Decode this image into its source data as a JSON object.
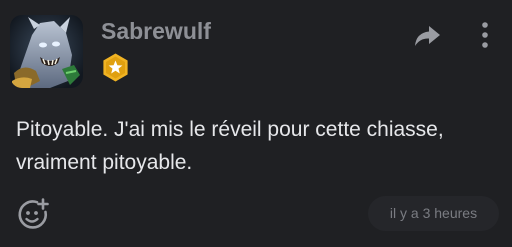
{
  "post": {
    "username": "Sabrewulf",
    "message": "Pitoyable. J'ai mis le réveil pour cette chiasse, vraiment pitoyable.",
    "timestamp": "il y a 3 heures"
  },
  "icons": {
    "share": "share-arrow-icon",
    "more": "vertical-dots-icon",
    "react": "add-emoji-icon",
    "badge": "star-badge-icon"
  },
  "colors": {
    "background": "#1f2023",
    "username": "#8e9096",
    "message": "#e6e7ea",
    "badge": "#f0b323",
    "timestamp_bg": "#25262a",
    "timestamp_text": "#7a7c82",
    "icon": "#9a9ca2"
  }
}
